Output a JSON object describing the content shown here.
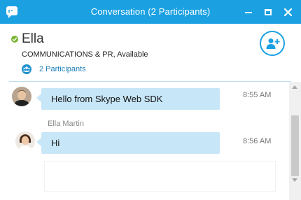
{
  "window": {
    "title": "Conversation (2 Participants)",
    "accent_color": "#1ba1e2",
    "controls": [
      "minimize-icon",
      "maximize-icon",
      "close-icon"
    ]
  },
  "header": {
    "contact_name": "Ella",
    "contact_status": "COMMUNICATIONS & PR,  Available",
    "presence": "available",
    "presence_color": "#7bb432",
    "participants_label": "2 Participants",
    "add_participant_icon": "add-person-icon"
  },
  "messages": [
    {
      "sender": "",
      "text": "Hello from Skype Web SDK",
      "time": "8:55 AM"
    },
    {
      "sender": "Ella Martin",
      "text": "Hi",
      "time": "8:56 AM"
    }
  ],
  "composer": {
    "value": ""
  }
}
